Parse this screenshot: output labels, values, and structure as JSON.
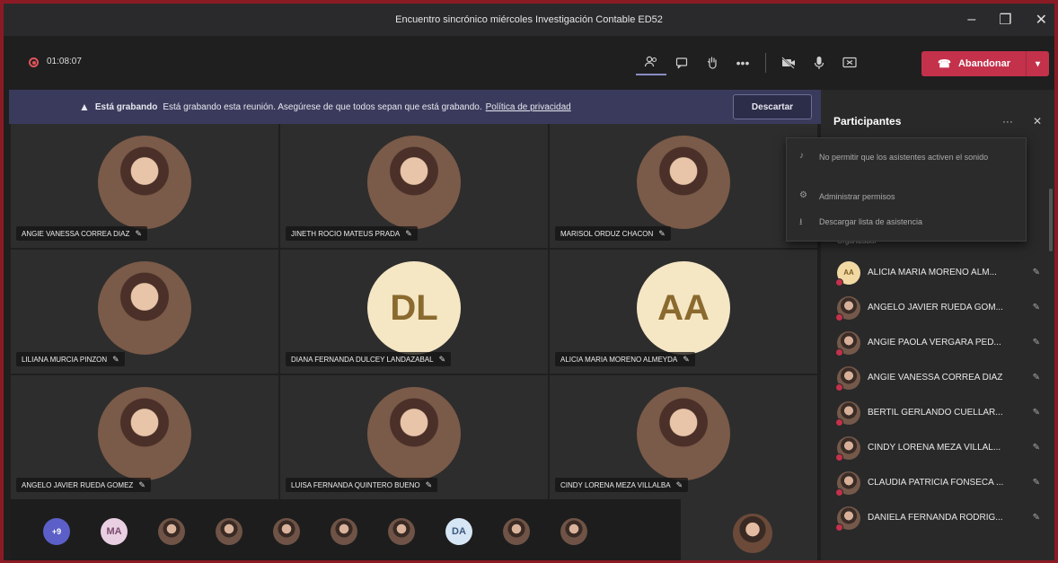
{
  "window": {
    "title": "Encuentro sincrónico miércoles Investigación Contable ED52",
    "minimize": "–",
    "maximize": "❐",
    "close": "✕"
  },
  "toolbar": {
    "timer": "01:08:07",
    "leave_label": "Abandonar"
  },
  "banner": {
    "bold": "Está grabando",
    "text": "Está grabando esta reunión. Asegúrese de que todos sepan que está grabando.",
    "link": "Política de privacidad",
    "dismiss": "Descartar"
  },
  "grid": [
    {
      "name": "ANGIE VANESSA CORREA DIAZ",
      "avatar": "photo"
    },
    {
      "name": "JINETH ROCIO MATEUS PRADA",
      "avatar": "photo"
    },
    {
      "name": "MARISOL ORDUZ CHACON",
      "avatar": "photo"
    },
    {
      "name": "LILIANA MURCIA PINZON",
      "avatar": "photo"
    },
    {
      "name": "DIANA FERNANDA DULCEY LANDAZABAL",
      "avatar": "initials",
      "initials": "DL"
    },
    {
      "name": "ALICIA MARIA MORENO ALMEYDA",
      "avatar": "initials",
      "initials": "AA"
    },
    {
      "name": "ANGELO JAVIER RUEDA GOMEZ",
      "avatar": "photo"
    },
    {
      "name": "LUISA FERNANDA QUINTERO BUENO",
      "avatar": "photo"
    },
    {
      "name": "CINDY LORENA MEZA VILLALBA",
      "avatar": "photo"
    }
  ],
  "strip": {
    "more": "+9",
    "initials_1": "MA",
    "initials_2": "DA"
  },
  "panel": {
    "title": "Participantes",
    "more": "···",
    "close": "✕",
    "peek": "Organizador",
    "menu": [
      "No permitir que los asistentes activen el sonido",
      "Administrar permisos",
      "Descargar lista de asistencia"
    ],
    "participants": [
      {
        "name": "ALICIA MARIA MORENO ALM...",
        "initials": "AA"
      },
      {
        "name": "ANGELO JAVIER RUEDA GOM..."
      },
      {
        "name": "ANGIE PAOLA VERGARA PED..."
      },
      {
        "name": "ANGIE VANESSA CORREA DIAZ"
      },
      {
        "name": "BERTIL GERLANDO CUELLAR..."
      },
      {
        "name": "CINDY LORENA MEZA VILLAL..."
      },
      {
        "name": "CLAUDIA PATRICIA FONSECA ..."
      },
      {
        "name": "DANIELA FERNANDA RODRIG..."
      }
    ]
  }
}
